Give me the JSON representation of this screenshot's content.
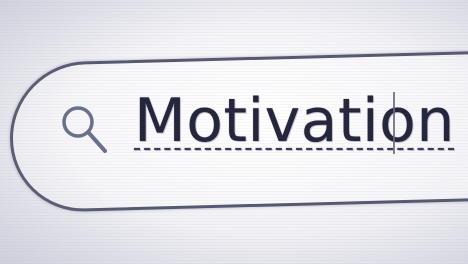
{
  "search": {
    "value": "Motivation",
    "icon": "search-icon"
  },
  "colors": {
    "border": "#55586e",
    "text": "#24243a",
    "icon": "#6a6f8c",
    "background": "#f4f4f8"
  }
}
